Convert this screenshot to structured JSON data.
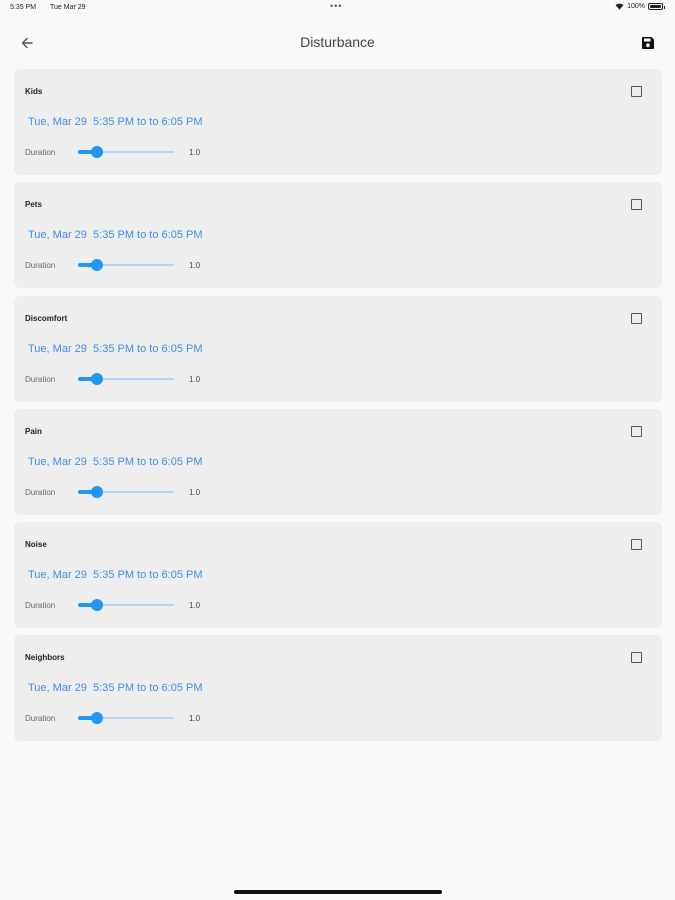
{
  "status_bar": {
    "time": "5:35 PM",
    "date": "Tue Mar 29",
    "dots": "•••",
    "battery": "100%"
  },
  "header": {
    "title": "Disturbance",
    "back_icon": "arrow-left-icon",
    "save_icon": "floppy-disk-icon"
  },
  "accent_color": "#2196f3",
  "link_color": "#3d8ee6",
  "slider": {
    "min": 0,
    "max": 5
  },
  "cards": [
    {
      "title": "Kids",
      "date": "Tue, Mar 29",
      "start": "5:35 PM to",
      "end": "to 6:05 PM",
      "duration_label": "Duration",
      "duration_value": "1.0",
      "checked": false
    },
    {
      "title": "Pets",
      "date": "Tue, Mar 29",
      "start": "5:35 PM to",
      "end": "to 6:05 PM",
      "duration_label": "Duration",
      "duration_value": "1.0",
      "checked": false
    },
    {
      "title": "Discomfort",
      "date": "Tue, Mar 29",
      "start": "5:35 PM to",
      "end": "to 6:05 PM",
      "duration_label": "Duration",
      "duration_value": "1.0",
      "checked": false
    },
    {
      "title": "Pain",
      "date": "Tue, Mar 29",
      "start": "5:35 PM to",
      "end": "to 6:05 PM",
      "duration_label": "Duration",
      "duration_value": "1.0",
      "checked": false
    },
    {
      "title": "Noise",
      "date": "Tue, Mar 29",
      "start": "5:35 PM to",
      "end": "to 6:05 PM",
      "duration_label": "Duration",
      "duration_value": "1.0",
      "checked": false
    },
    {
      "title": "Neighbors",
      "date": "Tue, Mar 29",
      "start": "5:35 PM to",
      "end": "to 6:05 PM",
      "duration_label": "Duration",
      "duration_value": "1.0",
      "checked": false
    }
  ]
}
